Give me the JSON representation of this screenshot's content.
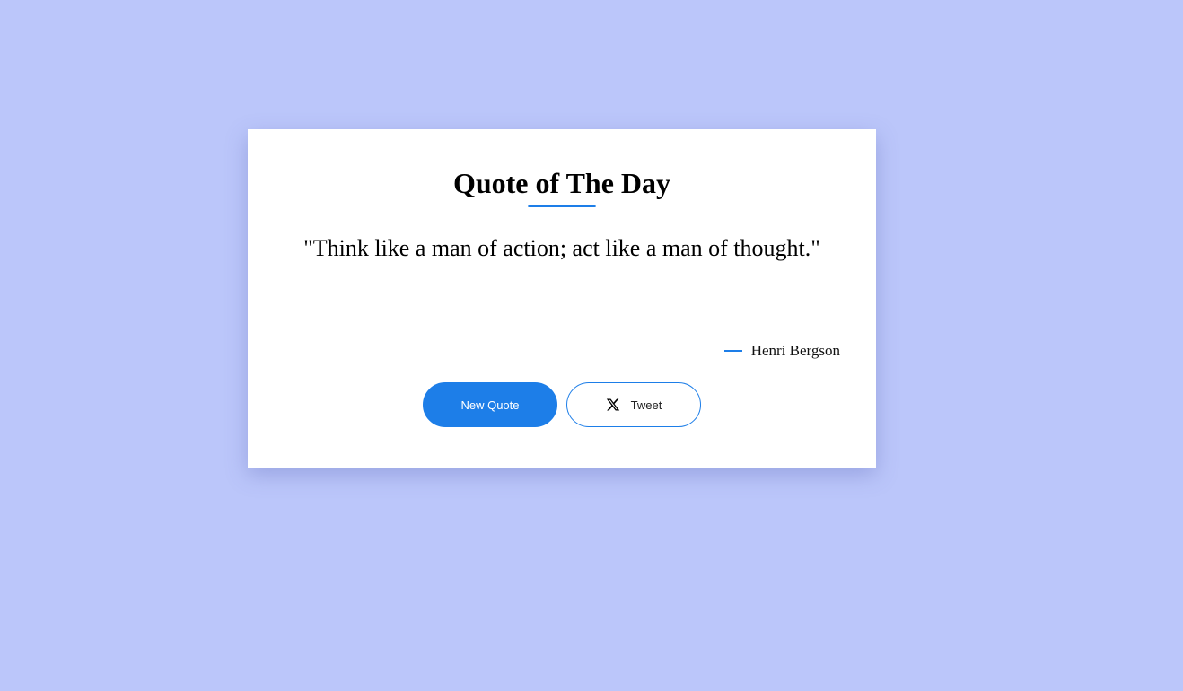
{
  "card": {
    "title": "Quote of The Day",
    "quote": "\"Think like a man of action; act like a man of thought.\"",
    "author": "Henri Bergson"
  },
  "buttons": {
    "new_quote_label": "New Quote",
    "tweet_label": "Tweet",
    "tweet_icon": "x-logo-icon"
  },
  "colors": {
    "background": "#bbc6fa",
    "accent": "#1d7ee8",
    "card": "#ffffff"
  }
}
